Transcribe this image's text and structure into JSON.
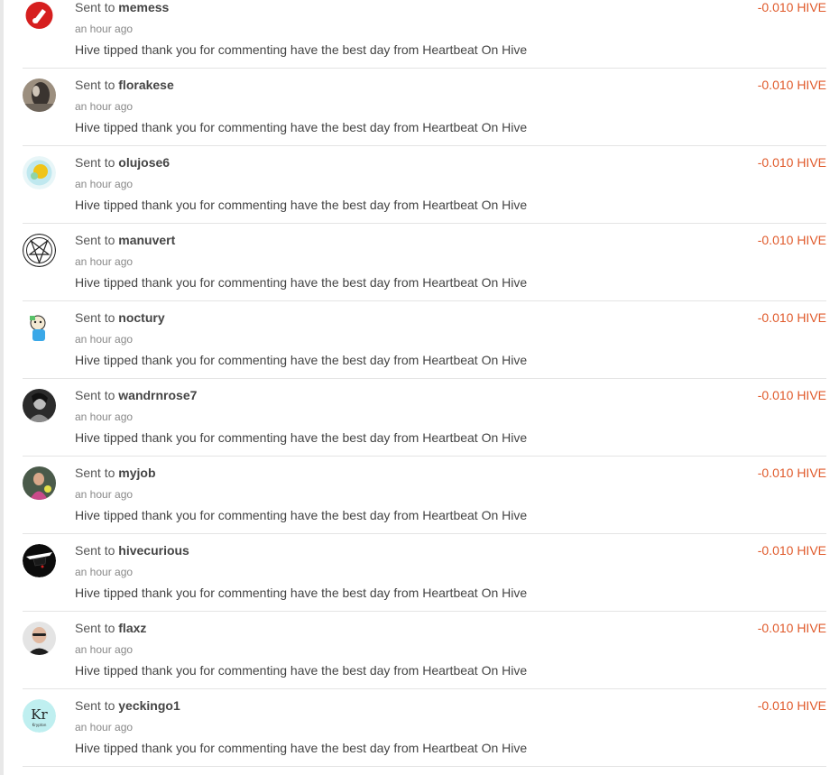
{
  "transfers": [
    {
      "prefix": "Sent to",
      "user": "memess",
      "time": "an hour ago",
      "memo": "Hive tipped thank you for commenting have the best day from Heartbeat On Hive",
      "amount": "-0.010 HIVE",
      "avatar": "red-badge-avatar"
    },
    {
      "prefix": "Sent to",
      "user": "florakese",
      "time": "an hour ago",
      "memo": "Hive tipped thank you for commenting have the best day from Heartbeat On Hive",
      "amount": "-0.010 HIVE",
      "avatar": "photo-avatar"
    },
    {
      "prefix": "Sent to",
      "user": "olujose6",
      "time": "an hour ago",
      "memo": "Hive tipped thank you for commenting have the best day from Heartbeat On Hive",
      "amount": "-0.010 HIVE",
      "avatar": "bubble-avatar"
    },
    {
      "prefix": "Sent to",
      "user": "manuvert",
      "time": "an hour ago",
      "memo": "Hive tipped thank you for commenting have the best day from Heartbeat On Hive",
      "amount": "-0.010 HIVE",
      "avatar": "pentagram-avatar"
    },
    {
      "prefix": "Sent to",
      "user": "noctury",
      "time": "an hour ago",
      "memo": "Hive tipped thank you for commenting have the best day from Heartbeat On Hive",
      "amount": "-0.010 HIVE",
      "avatar": "cartoon-avatar"
    },
    {
      "prefix": "Sent to",
      "user": "wandrnrose7",
      "time": "an hour ago",
      "memo": "Hive tipped thank you for commenting have the best day from Heartbeat On Hive",
      "amount": "-0.010 HIVE",
      "avatar": "bw-photo-avatar"
    },
    {
      "prefix": "Sent to",
      "user": "myjob",
      "time": "an hour ago",
      "memo": "Hive tipped thank you for commenting have the best day from Heartbeat On Hive",
      "amount": "-0.010 HIVE",
      "avatar": "person-photo-avatar"
    },
    {
      "prefix": "Sent to",
      "user": "hivecurious",
      "time": "an hour ago",
      "memo": "Hive tipped thank you for commenting have the best day from Heartbeat On Hive",
      "amount": "-0.010 HIVE",
      "avatar": "hat-silhouette-avatar"
    },
    {
      "prefix": "Sent to",
      "user": "flaxz",
      "time": "an hour ago",
      "memo": "Hive tipped thank you for commenting have the best day from Heartbeat On Hive",
      "amount": "-0.010 HIVE",
      "avatar": "bald-man-avatar"
    },
    {
      "prefix": "Sent to",
      "user": "yeckingo1",
      "time": "an hour ago",
      "memo": "Hive tipped thank you for commenting have the best day from Heartbeat On Hive",
      "amount": "-0.010 HIVE",
      "avatar": "kr-element-avatar",
      "avatar_text": "Kr",
      "avatar_subtext": "Krypton"
    }
  ],
  "colors": {
    "amount": "#e05a2b",
    "divider": "#e4e4e4"
  }
}
